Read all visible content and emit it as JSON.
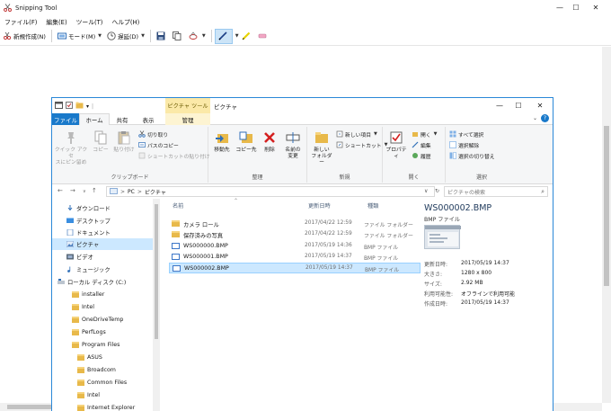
{
  "snipping_tool": {
    "title": "Snipping Tool",
    "menu": [
      "ファイル(F)",
      "編集(E)",
      "ツール(T)",
      "ヘルプ(H)"
    ],
    "toolbar": {
      "new_label": "新規作成(N)",
      "mode_label": "モード(M)",
      "delay_label": "遅延(D)"
    },
    "window_controls": {
      "minimize": "—",
      "maximize": "☐",
      "close": "✕"
    }
  },
  "explorer": {
    "title": "ピクチャ",
    "context_tab_header": "ピクチャ ツール",
    "tabs": {
      "file": "ファイル",
      "home": "ホーム",
      "share": "共有",
      "view": "表示",
      "manage": "管理"
    },
    "help": "?",
    "ribbon": {
      "clipboard": {
        "label": "クリップボード",
        "pin_quick": "クイック アクセ",
        "pin_quick2": "スにピン留め",
        "copy": "コピー",
        "paste": "貼り付け",
        "cut": "切り取り",
        "copy_path": "パスのコピー",
        "paste_shortcut": "ショートカットの貼り付け"
      },
      "organize": {
        "label": "整理",
        "move_to": "移動先",
        "copy_to": "コピー先",
        "delete": "削除",
        "rename": "名前の",
        "rename2": "変更"
      },
      "new": {
        "label": "新規",
        "new_folder": "新しい",
        "new_folder2": "フォルダー",
        "new_item": "新しい項目",
        "shortcut": "ショートカット"
      },
      "open": {
        "label": "開く",
        "properties": "プロパティ",
        "open": "開く",
        "edit": "編集",
        "history": "履歴"
      },
      "select": {
        "label": "選択",
        "select_all": "すべて選択",
        "select_none": "選択解除",
        "invert": "選択の切り替え"
      }
    },
    "address": {
      "path_pc": "PC",
      "sep": ">",
      "path_folder": "ピクチャ",
      "search_placeholder": "ピクチャの検索"
    },
    "nav_pane": [
      "ダウンロード",
      "デスクトップ",
      "ドキュメント",
      "ピクチャ",
      "ビデオ",
      "ミュージック",
      "ローカル ディスク (C:)",
      "installer",
      "Intel",
      "OneDriveTemp",
      "PerfLogs",
      "Program Files",
      "ASUS",
      "Broadcom",
      "Common Files",
      "Intel",
      "Internet Explorer"
    ],
    "columns": {
      "name": "名前",
      "date": "更新日時",
      "type": "種類"
    },
    "files": [
      {
        "name": "カメラ ロール",
        "date": "2017/04/22 12:59",
        "type": "ファイル フォルダー"
      },
      {
        "name": "保存済みの写真",
        "date": "2017/04/22 12:59",
        "type": "ファイル フォルダー"
      },
      {
        "name": "WS000000.BMP",
        "date": "2017/05/19 14:36",
        "type": "BMP ファイル"
      },
      {
        "name": "WS000001.BMP",
        "date": "2017/05/19 14:37",
        "type": "BMP ファイル"
      },
      {
        "name": "WS000002.BMP",
        "date": "2017/05/19 14:37",
        "type": "BMP ファイル"
      }
    ],
    "preview": {
      "name": "WS000002.BMP",
      "type": "BMP ファイル",
      "props": [
        {
          "k": "更新日時:",
          "v": "2017/05/19 14:37"
        },
        {
          "k": "大きさ:",
          "v": "1280 x 800"
        },
        {
          "k": "サイズ:",
          "v": "2.92 MB"
        },
        {
          "k": "利用可能性:",
          "v": "オフラインで利用可能"
        },
        {
          "k": "作成日時:",
          "v": "2017/05/19 14:37"
        }
      ]
    }
  },
  "colors": {
    "accent": "#1979ca",
    "selection": "#cce8ff",
    "context_tab": "#fbe9a8",
    "folder": "#e8b94a"
  }
}
